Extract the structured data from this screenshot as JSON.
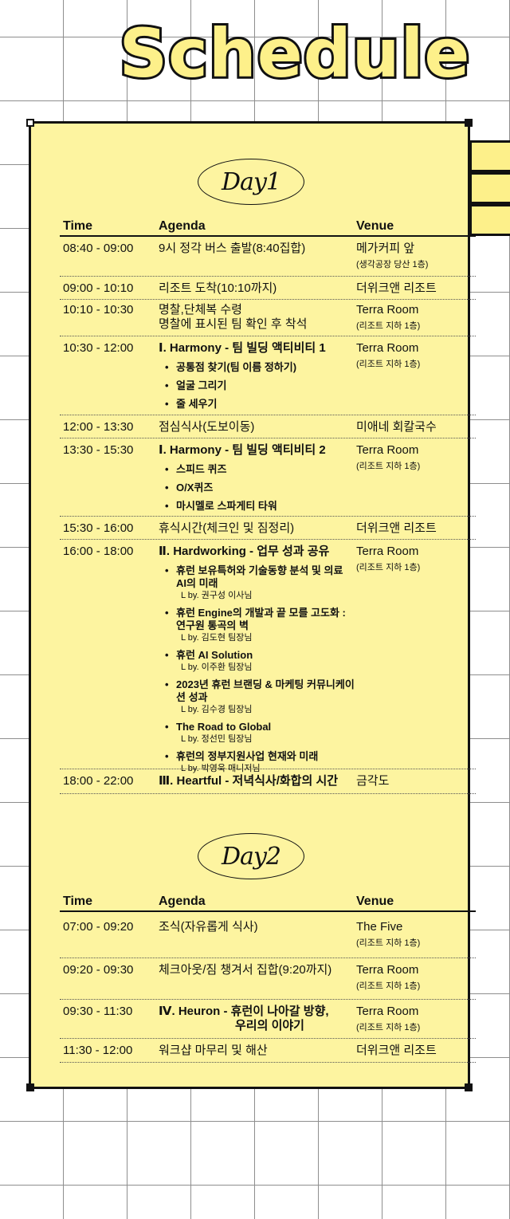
{
  "title": "Schedule",
  "day1": {
    "label": "Day1",
    "headers": {
      "time": "Time",
      "agenda": "Agenda",
      "venue": "Venue"
    },
    "rows": [
      {
        "time": "08:40 - 09:00",
        "agenda": "9시 정각 버스 출발(8:40집합)",
        "venue": "메가커피 앞",
        "venue_sub": "(생각공장 당산 1층)"
      },
      {
        "time": "09:00 - 10:10",
        "agenda": "리조트 도착(10:10까지)",
        "venue": "더위크앤 리조트"
      },
      {
        "time": "10:10 - 10:30",
        "agenda": "명찰,단체복 수령",
        "agenda2": "명찰에 표시된 팀 확인 후 착석",
        "venue": "Terra Room",
        "venue_sub": "(리조트 지하 1층)"
      },
      {
        "time": "10:30 - 12:00",
        "agenda": "Ⅰ. Harmony - 팀 빌딩 액티비티 1",
        "bullets": [
          "공통점 찾기(팀 이름 정하기)",
          "얼굴 그리기",
          "줄 세우기"
        ],
        "venue": "Terra Room",
        "venue_sub": "(리조트 지하 1층)"
      },
      {
        "time": "12:00 - 13:30",
        "agenda": "점심식사(도보이동)",
        "venue": "미애네 회칼국수"
      },
      {
        "time": "13:30 - 15:30",
        "agenda": "Ⅰ. Harmony - 팀 빌딩 액티비티 2",
        "bullets": [
          "스피드 퀴즈",
          "O/X퀴즈",
          "마시멜로 스파게티 타워"
        ],
        "venue": "Terra Room",
        "venue_sub": "(리조트 지하 1층)"
      },
      {
        "time": "15:30 - 16:00",
        "agenda": "휴식시간(체크인 및 짐정리)",
        "venue": "더위크앤 리조트"
      },
      {
        "time": "16:00 - 18:00",
        "agenda": "Ⅱ. Hardworking - 업무 성과 공유",
        "venue": "Terra Room",
        "venue_sub": "(리조트 지하 1층)",
        "talks": [
          {
            "title": "휴런 보유특허와 기술동향 분석 및 의료 AI의 미래",
            "by": "L by. 권구성 이사님"
          },
          {
            "title": "휴런 Engine의 개발과 끝 모를 고도화 : 연구원 통곡의 벽",
            "by": "L by. 김도현 팀장님"
          },
          {
            "title": "휴런 AI Solution",
            "by": "L by. 이주환 팀장님"
          },
          {
            "title": "2023년 휴런 브랜딩 & 마케팅 커뮤니케이션 성과",
            "by": "L by. 김수경 팀장님"
          },
          {
            "title": "The Road to Global",
            "by": "L by. 정선민 팀장님"
          },
          {
            "title": "휴런의 정부지원사업 현재와 미래",
            "by": "L by. 박영욱 매니저님"
          }
        ]
      },
      {
        "time": "18:00 - 22:00",
        "agenda": "Ⅲ. Heartful - 저녁식사/화합의 시간",
        "venue": "금각도"
      }
    ]
  },
  "day2": {
    "label": "Day2",
    "headers": {
      "time": "Time",
      "agenda": "Agenda",
      "venue": "Venue"
    },
    "rows": [
      {
        "time": "07:00 - 09:20",
        "agenda": "조식(자유롭게 식사)",
        "venue": "The Five",
        "venue_sub": "(리조트 지하 1층)"
      },
      {
        "time": "09:20 - 09:30",
        "agenda": "체크아웃/짐 챙겨서 집합(9:20까지)",
        "venue": "Terra Room",
        "venue_sub": "(리조트 지하 1층)"
      },
      {
        "time": "09:30 - 11:30",
        "agenda": "Ⅳ. Heuron - 휴런이 나아갈 방향,",
        "agenda2": "우리의 이야기",
        "venue": "Terra Room",
        "venue_sub": "(리조트 지하 1층)"
      },
      {
        "time": "11:30 - 12:00",
        "agenda": "워크샵 마무리 및 해산",
        "venue": "더위크앤 리조트"
      }
    ]
  }
}
